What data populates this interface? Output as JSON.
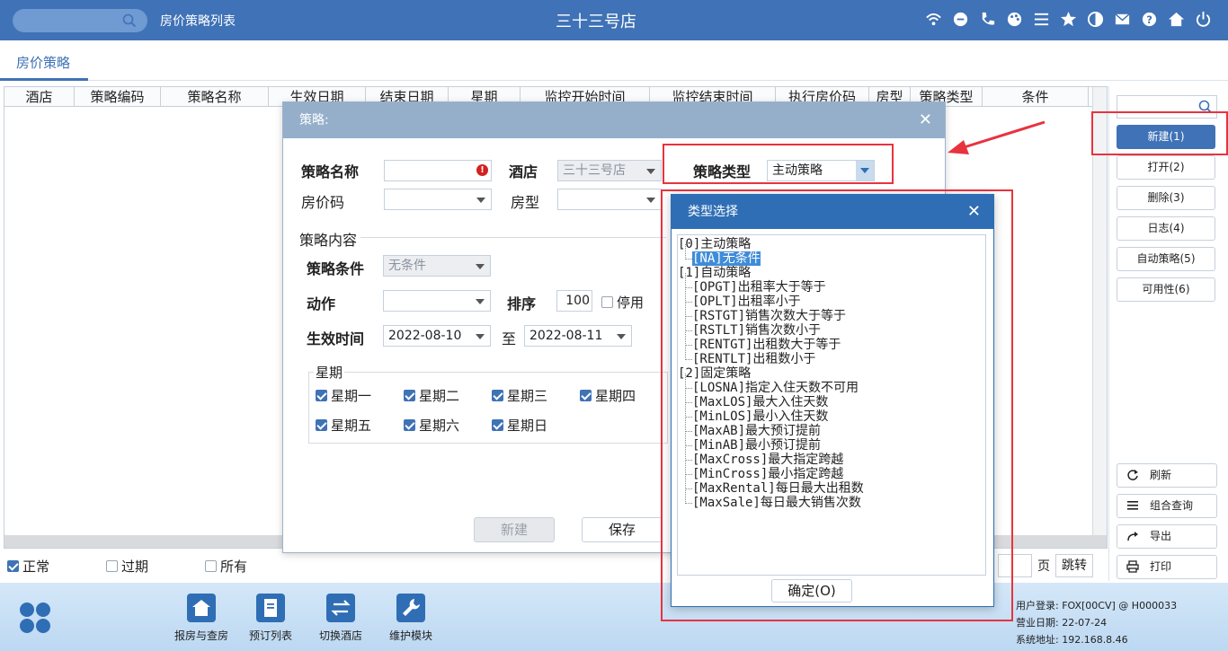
{
  "header": {
    "breadcrumb": "房价策略列表",
    "store_name": "三十三号店",
    "icons": [
      "wifi-icon",
      "chat-icon",
      "phone-icon",
      "palette-icon",
      "menu-icon",
      "star-icon",
      "theme-icon",
      "mail-icon",
      "help-icon",
      "home-icon",
      "power-icon"
    ]
  },
  "tab": {
    "label": "房价策略"
  },
  "grid": {
    "columns": [
      "酒店",
      "策略编码",
      "策略名称",
      "生效日期",
      "结束日期",
      "星期",
      "监控开始时间",
      "监控结束时间",
      "执行房价码",
      "房型",
      "策略类型",
      "条件"
    ]
  },
  "filter": {
    "normal": "正常",
    "expired": "过期",
    "all": "所有"
  },
  "pager": {
    "page_unit": "页",
    "jump": "跳转"
  },
  "right_panel": {
    "new": "新建(1)",
    "open": "打开(2)",
    "delete": "删除(3)",
    "log": "日志(4)",
    "auto": "自动策略(5)",
    "availability": "可用性(6)",
    "refresh": "刷新",
    "combo_query": "组合查询",
    "export": "导出",
    "print": "打印"
  },
  "bottom": {
    "nav": [
      "报房与查房",
      "预订列表",
      "切换酒店",
      "维护模块"
    ],
    "user_login": "用户登录: FOX[00CV] @ H000033",
    "business_date": "营业日期: 22-07-24",
    "system_address": "系统地址: 192.168.8.46"
  },
  "dialog": {
    "title": "策略:",
    "name_label": "策略名称",
    "hotel_label": "酒店",
    "hotel_value": "三十三号店",
    "type_label": "策略类型",
    "type_value": "主动策略",
    "rate_code_label": "房价码",
    "room_type_label": "房型",
    "content_section": "策略内容",
    "condition_label": "策略条件",
    "condition_value": "无条件",
    "action_label": "动作",
    "sort_label": "排序",
    "sort_value": "100",
    "disable_label": "停用",
    "effective_label": "生效时间",
    "date_from": "2022-08-10",
    "date_to_label": "至",
    "date_to": "2022-08-11",
    "week_section": "星期",
    "weekdays": [
      "星期一",
      "星期二",
      "星期三",
      "星期四",
      "星期五",
      "星期六",
      "星期日"
    ],
    "new_btn": "新建",
    "save_btn": "保存"
  },
  "popup": {
    "title": "类型选择",
    "ok": "确定(O)",
    "tree": [
      {
        "text": "[0]主动策略",
        "level": 0
      },
      {
        "text": "[NA]无条件",
        "level": 1,
        "selected": true
      },
      {
        "text": "[1]自动策略",
        "level": 0
      },
      {
        "text": "[OPGT]出租率大于等于",
        "level": 1
      },
      {
        "text": "[OPLT]出租率小于",
        "level": 1
      },
      {
        "text": "[RSTGT]销售次数大于等于",
        "level": 1
      },
      {
        "text": "[RSTLT]销售次数小于",
        "level": 1
      },
      {
        "text": "[RENTGT]出租数大于等于",
        "level": 1
      },
      {
        "text": "[RENTLT]出租数小于",
        "level": 1
      },
      {
        "text": "[2]固定策略",
        "level": 0
      },
      {
        "text": "[LOSNA]指定入住天数不可用",
        "level": 1
      },
      {
        "text": "[MaxLOS]最大入住天数",
        "level": 1
      },
      {
        "text": "[MinLOS]最小入住天数",
        "level": 1
      },
      {
        "text": "[MaxAB]最大预订提前",
        "level": 1
      },
      {
        "text": "[MinAB]最小预订提前",
        "level": 1
      },
      {
        "text": "[MaxCross]最大指定跨越",
        "level": 1
      },
      {
        "text": "[MinCross]最小指定跨越",
        "level": 1
      },
      {
        "text": "[MaxRental]每日最大出租数",
        "level": 1
      },
      {
        "text": "[MaxSale]每日最大销售次数",
        "level": 1
      }
    ]
  },
  "colors": {
    "brand": "#3f72b6",
    "highlight": "#e8333f"
  }
}
